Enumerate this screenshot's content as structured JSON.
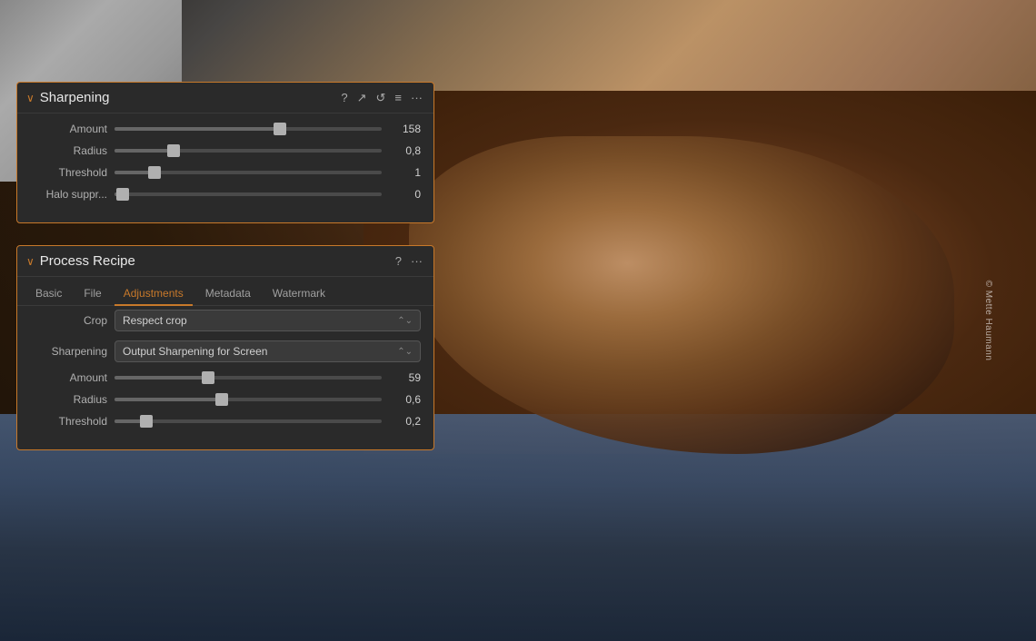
{
  "background": {
    "copyright": "© Mette Haumann"
  },
  "sharpening_panel": {
    "title": "Sharpening",
    "collapse_icon": "∨",
    "icons": [
      "?",
      "↗",
      "↺",
      "≡",
      "···"
    ],
    "sliders": [
      {
        "label": "Amount",
        "value": "158",
        "fill_pct": 62
      },
      {
        "label": "Radius",
        "value": "0,8",
        "fill_pct": 22
      },
      {
        "label": "Threshold",
        "value": "1",
        "fill_pct": 15
      },
      {
        "label": "Halo suppr...",
        "value": "0",
        "fill_pct": 3
      }
    ]
  },
  "process_panel": {
    "title": "Process Recipe",
    "collapse_icon": "∨",
    "icons": [
      "?",
      "···"
    ],
    "tabs": [
      {
        "label": "Basic",
        "active": false
      },
      {
        "label": "File",
        "active": false
      },
      {
        "label": "Adjustments",
        "active": true
      },
      {
        "label": "Metadata",
        "active": false
      },
      {
        "label": "Watermark",
        "active": false
      }
    ],
    "crop_label": "Crop",
    "crop_value": "Respect crop",
    "sharpening_label": "Sharpening",
    "sharpening_value": "Output Sharpening for Screen",
    "sliders": [
      {
        "label": "Amount",
        "value": "59",
        "fill_pct": 35
      },
      {
        "label": "Radius",
        "value": "0,6",
        "fill_pct": 40
      },
      {
        "label": "Threshold",
        "value": "0,2",
        "fill_pct": 12
      }
    ]
  }
}
